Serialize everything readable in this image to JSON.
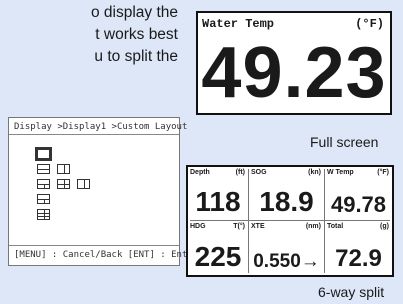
{
  "manual_text": {
    "line1": "o display the",
    "line2": "t works best",
    "line3": "u to split the"
  },
  "full_screen": {
    "label": "Water Temp",
    "unit": "(°F)",
    "value": "49.23",
    "caption": "Full screen"
  },
  "menu": {
    "breadcrumb": "Display >Display1 >Custom Layout",
    "footer": "[MENU] : Cancel/Back  [ENT] : Enter",
    "layout_options": [
      "single",
      "2-way horizontal",
      "2-way split",
      "4-way",
      "4-way wide",
      "6-way",
      "3-way",
      "6-way split"
    ]
  },
  "split_screen": {
    "caption": "6-way split",
    "cells": [
      {
        "label": "Depth",
        "unit": "(ft)",
        "value": "118"
      },
      {
        "label": "SOG",
        "unit": "(kn)",
        "value": "18.9"
      },
      {
        "label": "W Temp",
        "unit": "(°F)",
        "value": "49.78"
      },
      {
        "label": "HDG",
        "unit": "T(°)",
        "value": "225"
      },
      {
        "label": "XTE",
        "unit": "(nm)",
        "value": "0.550→"
      },
      {
        "label": "Total",
        "unit": "(g)",
        "value": "72.9"
      }
    ]
  }
}
